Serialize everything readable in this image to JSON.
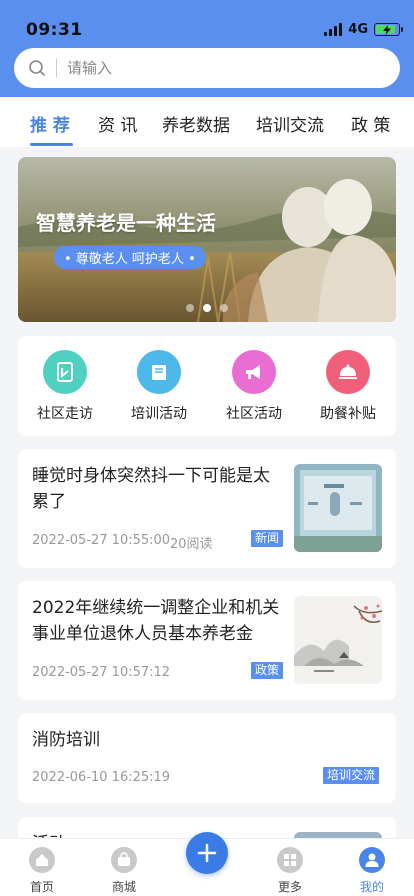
{
  "status": {
    "time": "09:31",
    "network": "4G"
  },
  "search": {
    "placeholder": "请输入"
  },
  "tabs": [
    {
      "label": "推 荐",
      "active": true
    },
    {
      "label": "资 讯"
    },
    {
      "label": "养老数据"
    },
    {
      "label": "培训交流"
    },
    {
      "label": "政 策"
    }
  ],
  "banner": {
    "title": "智慧养老是一种生活",
    "subtitle": "• 尊敬老人 呵护老人 •",
    "active_dot": 1
  },
  "quick_links": [
    {
      "label": "社区走访",
      "icon": "community-visit-icon",
      "color": "#4fd0c0"
    },
    {
      "label": "培训活动",
      "icon": "book-icon",
      "color": "#4fb8ea"
    },
    {
      "label": "社区活动",
      "icon": "megaphone-icon",
      "color": "#e86cd2"
    },
    {
      "label": "助餐补贴",
      "icon": "food-cloche-icon",
      "color": "#f0607a"
    }
  ],
  "news": [
    {
      "title": "睡觉时身体突然抖一下可能是太累了",
      "time": "2022-05-27 10:55:00",
      "reads": "20阅读",
      "tag": "新闻"
    },
    {
      "title": "2022年继续统一调整企业和机关事业单位退休人员基本养老金",
      "time": "2022-05-27 10:57:12",
      "tag": "政策"
    },
    {
      "title": "消防培训",
      "time": "2022-06-10 16:25:19",
      "tag": "培训交流"
    },
    {
      "title": "活动"
    }
  ],
  "tabbar": [
    {
      "label": "首页",
      "icon": "home-icon"
    },
    {
      "label": "商城",
      "icon": "shop-icon"
    },
    {
      "label": "更多",
      "icon": "grid-icon"
    },
    {
      "label": "我的",
      "icon": "user-icon",
      "active": true
    }
  ],
  "colors": {
    "primary": "#5a8ff0",
    "accent": "#4a86e8"
  }
}
